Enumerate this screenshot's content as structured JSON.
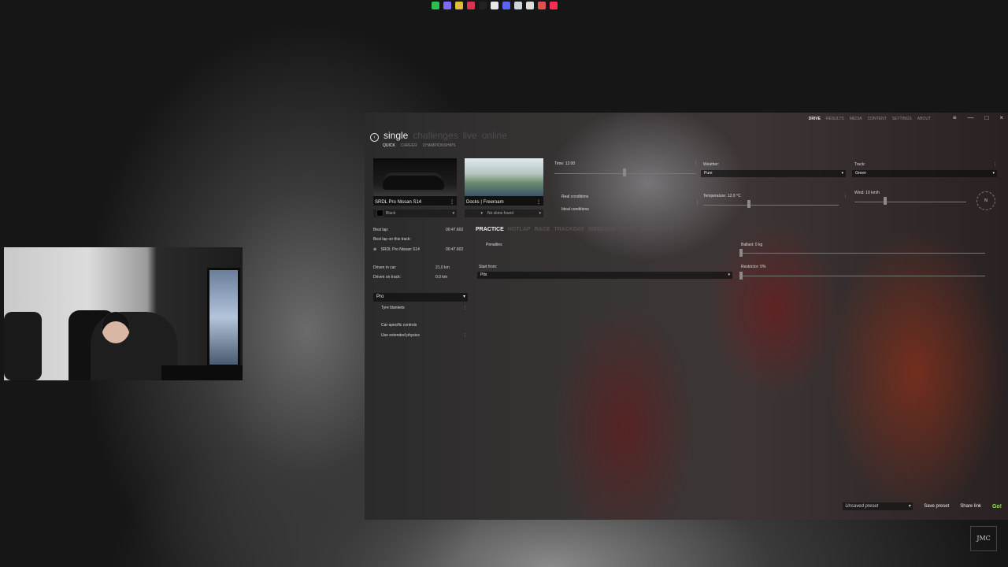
{
  "taskbar": {
    "icons": [
      "app-icon-clover",
      "app-icon-purple",
      "app-icon-folder",
      "app-icon-red",
      "app-icon-dark",
      "app-icon-chrome",
      "app-icon-discord",
      "app-icon-steam",
      "app-icon-obs",
      "app-icon-arrow",
      "app-icon-tiktok"
    ],
    "colors": [
      "#2fbf4f",
      "#7b6cf0",
      "#e7b93d",
      "#d8344d",
      "#222222",
      "#e8e8e8",
      "#5865f2",
      "#cfd3db",
      "#dddddd",
      "#e05050",
      "#ff2d55"
    ]
  },
  "topnav": {
    "drive": "DRIVE",
    "items": [
      "RESULTS",
      "MEDIA",
      "CONTENT",
      "SETTINGS",
      "ABOUT"
    ],
    "window_controls": [
      "≡",
      "—",
      "□",
      "×"
    ]
  },
  "modes": [
    "single",
    "challenges",
    "live",
    "online"
  ],
  "submodes": [
    "QUICK",
    "CAREER",
    "CHAMPIONSHIPS"
  ],
  "car": {
    "name": "SRDL Pro Nissan S14",
    "more": "⋮",
    "skin": "Black"
  },
  "track": {
    "name": "Docks | Freeroam",
    "more": "⋮",
    "skin": "No skins found"
  },
  "stats": {
    "best_lap_label": "Best lap:",
    "best_lap_value": "00:47.602",
    "best_lap_track_label": "Best lap on this track:",
    "best_lap_track_car": "SRDL Pro Nissan S14",
    "best_lap_track_value": "00:47.602",
    "driven_in_car_label": "Driven in car:",
    "driven_in_car_value": "21.0 km",
    "driven_on_track_label": "Driven on track:",
    "driven_on_track_value": "0.0 km"
  },
  "assists": {
    "preset": "Pro",
    "tyre_blankets": "Tyre blankets",
    "car_specific": "Car-specific controls",
    "extended_physics": "Use extended physics"
  },
  "section_tabs": [
    "PRACTICE",
    "HOTLAP",
    "RACE",
    "TRACKDAY",
    "WEEKEND",
    "DRIFT",
    "DRAG RACE"
  ],
  "practice": {
    "penalties": "Penalties",
    "start_from_label": "Start from:",
    "start_from_value": "Pits",
    "ballast": "Ballast: 0 kg",
    "restrictor": "Restrictor: 0%"
  },
  "conditions": {
    "time": "Time: 12:00",
    "real_conditions": "Real conditions",
    "ideal_conditions": "Ideal conditions",
    "weather_label": "Weather:",
    "weather_value": "Pure",
    "temperature": "Temperature: 12.0 °C",
    "track_label": "Track:",
    "track_value": "Green",
    "wind": "Wind: 10 km/h",
    "compass": "N"
  },
  "bottom": {
    "preset": "Unsaved preset",
    "save": "Save preset",
    "share": "Share link",
    "go": "Go!"
  },
  "overlay_logo": "JMC"
}
